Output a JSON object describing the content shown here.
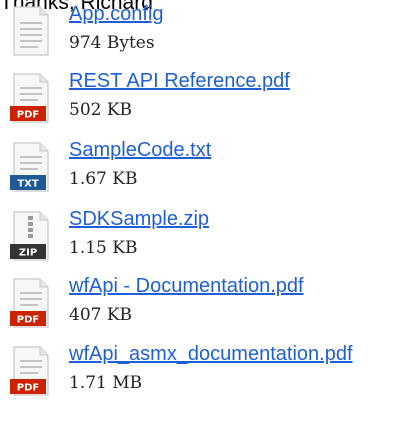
{
  "sender_signature": "Thanks, Richard",
  "badge_color": "#cc2200",
  "attachments": [
    {
      "name": "App.config",
      "size": "974 Bytes",
      "icon": "generic-file-icon",
      "badge": ""
    },
    {
      "name": "REST API Reference.pdf",
      "size": "502 KB",
      "icon": "pdf-file-icon",
      "badge": "PDF"
    },
    {
      "name": "SampleCode.txt",
      "size": "1.67 KB",
      "icon": "txt-file-icon",
      "badge": "TXT"
    },
    {
      "name": "SDKSample.zip",
      "size": "1.15 KB",
      "icon": "zip-file-icon",
      "badge": "ZIP"
    },
    {
      "name": "wfApi - Documentation.pdf",
      "size": "407 KB",
      "icon": "pdf-file-icon",
      "badge": "PDF"
    },
    {
      "name": "wfApi_asmx_documentation.pdf",
      "size": "1.71 MB",
      "icon": "pdf-file-icon",
      "badge": "PDF"
    }
  ]
}
